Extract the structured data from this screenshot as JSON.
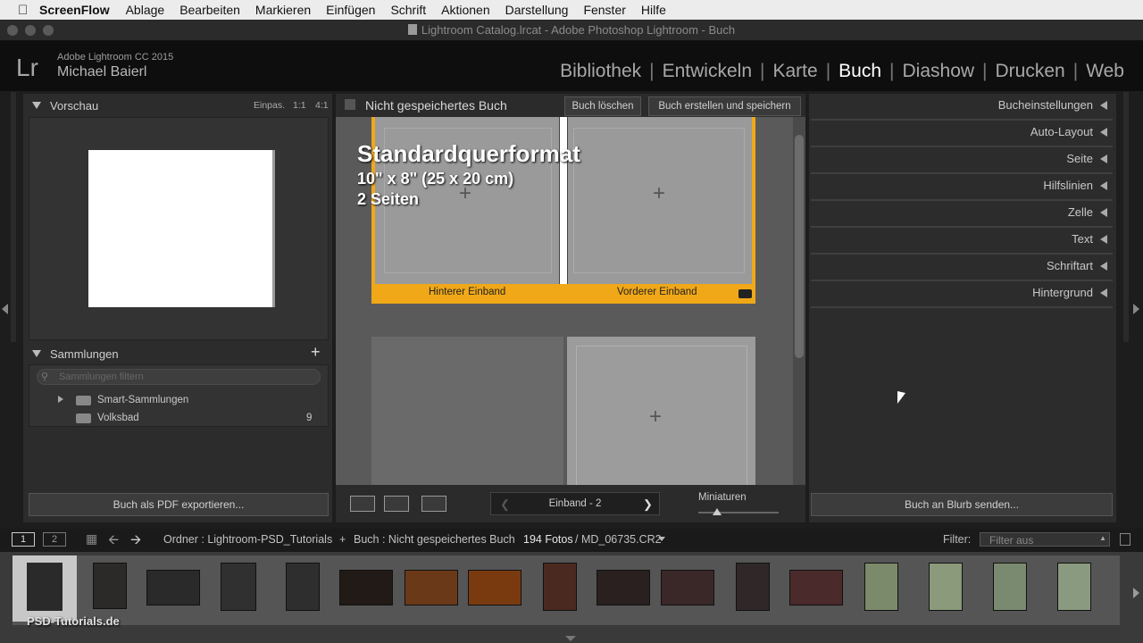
{
  "menubar": {
    "app": "ScreenFlow",
    "items": [
      "Ablage",
      "Bearbeiten",
      "Markieren",
      "Einfügen",
      "Schrift",
      "Aktionen",
      "Darstellung",
      "Fenster",
      "Hilfe"
    ]
  },
  "window": {
    "title": "Lightroom Catalog.lrcat - Adobe Photoshop Lightroom - Buch"
  },
  "identity": {
    "logo": "Lr",
    "version": "Adobe Lightroom CC 2015",
    "user": "Michael Baierl"
  },
  "modules": [
    "Bibliothek",
    "Entwickeln",
    "Karte",
    "Buch",
    "Diashow",
    "Drucken",
    "Web"
  ],
  "active_module": "Buch",
  "left": {
    "preview_title": "Vorschau",
    "zoom_fit": "Einpas.",
    "zoom_1": "1:1",
    "zoom_4": "4:1",
    "collections_title": "Sammlungen",
    "add": "+",
    "filter_placeholder": "Sammlungen filtern",
    "items": [
      {
        "name": "Smart-Sammlungen",
        "count": ""
      },
      {
        "name": "Volksbad",
        "count": "9"
      }
    ],
    "export_button": "Buch als PDF exportieren..."
  },
  "center": {
    "book_title": "Nicht gespeichertes Buch",
    "delete_button": "Buch löschen",
    "create_button": "Buch erstellen und speichern",
    "format_name": "Standardquerformat",
    "format_size": "10\" x 8\" (25 x 20 cm)",
    "format_pages": "2 Seiten",
    "back_cover": "Hinterer Einband",
    "front_cover": "Vorderer Einband",
    "page_label": "Einband - 2",
    "miniatures": "Miniaturen",
    "accent": "#f0a818"
  },
  "right": {
    "items": [
      "Bucheinstellungen",
      "Auto-Layout",
      "Seite",
      "Hilfslinien",
      "Zelle",
      "Text",
      "Schriftart",
      "Hintergrund"
    ],
    "send_button": "Buch an Blurb senden..."
  },
  "filmstrip": {
    "page1": "1",
    "page2": "2",
    "source": "Ordner : Lightroom-PSD_Tutorials",
    "plus": "+",
    "book": "Buch : Nicht gespeichertes Buch",
    "count": "194 Fotos",
    "file": "/ MD_06735.CR2",
    "filter_label": "Filter:",
    "filter_value": "Filter aus",
    "watermark": "PSD-Tutorials.de"
  }
}
